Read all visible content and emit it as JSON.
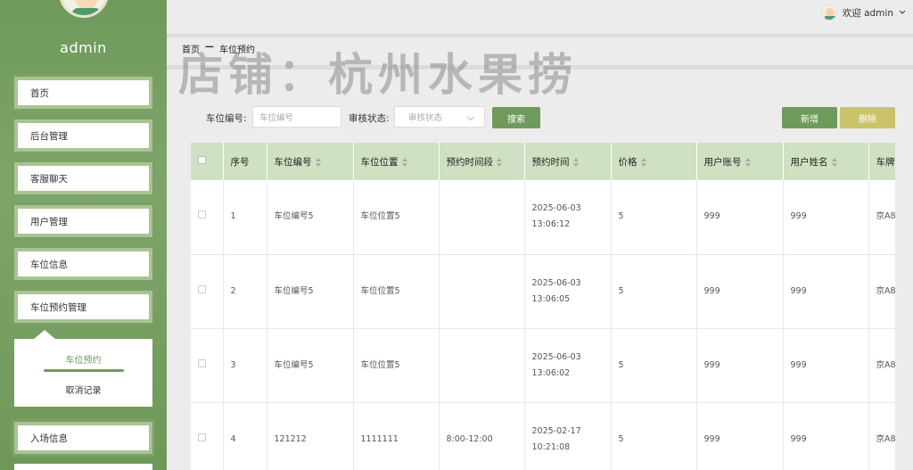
{
  "sidebar": {
    "username": "admin",
    "items": [
      {
        "label": "首页"
      },
      {
        "label": "后台管理"
      },
      {
        "label": "客服聊天"
      },
      {
        "label": "用户管理"
      },
      {
        "label": "车位信息"
      },
      {
        "label": "车位预约管理"
      }
    ],
    "submenu": [
      {
        "label": "车位预约",
        "active": true
      },
      {
        "label": "取消记录",
        "active": false
      }
    ],
    "after_items": [
      {
        "label": "入场信息"
      }
    ]
  },
  "header": {
    "welcome": "欢迎 admin",
    "chevron": "chevron-down-icon"
  },
  "watermark": {
    "banner": "店铺：杭州水果捞"
  },
  "breadcrumb": {
    "home": "首页",
    "sep": "—",
    "current": "车位预约"
  },
  "search": {
    "code_label": "车位编号:",
    "code_placeholder": "车位编号",
    "status_label": "审核状态:",
    "status_placeholder": "审核状态",
    "search_btn": "搜索",
    "add_btn": "新增",
    "delete_btn": "删除"
  },
  "colors": {
    "accent": "#6f9a5c",
    "delete": "#c9c46a",
    "header_row": "#cfe1c2"
  },
  "table": {
    "columns": [
      "序号",
      "车位编号",
      "车位位置",
      "预约时间段",
      "预约时间",
      "价格",
      "用户账号",
      "用户姓名",
      "车牌"
    ],
    "rows": [
      {
        "no": "1",
        "code": "车位编号5",
        "location": "车位位置5",
        "period": "",
        "time": "2025-06-03 13:06:12",
        "price": "5",
        "account": "999",
        "name": "999",
        "plate": "京A8"
      },
      {
        "no": "2",
        "code": "车位编号5",
        "location": "车位位置5",
        "period": "",
        "time": "2025-06-03 13:06:05",
        "price": "5",
        "account": "999",
        "name": "999",
        "plate": "京A8"
      },
      {
        "no": "3",
        "code": "车位编号5",
        "location": "车位位置5",
        "period": "",
        "time": "2025-06-03 13:06:02",
        "price": "5",
        "account": "999",
        "name": "999",
        "plate": "京A8"
      },
      {
        "no": "4",
        "code": "121212",
        "location": "1111111",
        "period": "8:00-12:00",
        "time": "2025-02-17 10:21:08",
        "price": "5",
        "account": "999",
        "name": "999",
        "plate": "京A8"
      }
    ]
  }
}
